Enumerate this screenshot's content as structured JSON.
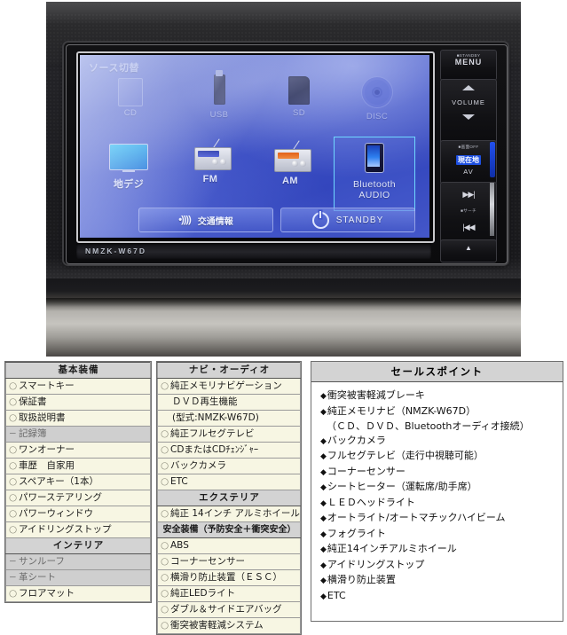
{
  "photo": {
    "alt_name": "car-audio-head-unit-photo",
    "device_model_badge": "NMZK-W67D",
    "screen": {
      "title": "ソース切替",
      "sources_row1": [
        {
          "label": "CD",
          "icon": "cd-icon"
        },
        {
          "label": "USB",
          "icon": "usb-icon"
        },
        {
          "label": "SD",
          "icon": "sd-card-icon"
        },
        {
          "label": "DISC",
          "icon": "disc-icon"
        }
      ],
      "sources_row2": [
        {
          "label": "地デジ",
          "icon": "tv-icon"
        },
        {
          "label": "FM",
          "icon": "radio-fm-icon"
        },
        {
          "label": "AM",
          "icon": "radio-am-icon"
        },
        {
          "label": "Bluetooth",
          "label2": "AUDIO",
          "icon": "smartphone-icon"
        }
      ],
      "traffic_button": "交通情報",
      "standby_button": "STANDBY"
    },
    "hardware_buttons": {
      "menu_caption": "■STANDBY",
      "menu_label": "MENU",
      "volume_label": "VOLUME",
      "av_caption": "■画面OFF",
      "av_blue": "現在地",
      "av_label": "AV",
      "track_next": "▶▶|",
      "track_caption": "■サーチ",
      "track_prev": "|◀◀",
      "eject": "▲"
    }
  },
  "col1": {
    "header": "基本装備",
    "rows": [
      {
        "mark": "○",
        "text": "スマートキー",
        "state": "on"
      },
      {
        "mark": "○",
        "text": "保証書",
        "state": "on"
      },
      {
        "mark": "○",
        "text": "取扱説明書",
        "state": "on"
      },
      {
        "mark": "−",
        "text": "記録簿",
        "state": "off"
      },
      {
        "mark": "○",
        "text": "ワンオーナー",
        "state": "on"
      },
      {
        "mark": "○",
        "text": "車歴　自家用",
        "state": "on"
      },
      {
        "mark": "○",
        "text": "スペアキー（1本）",
        "state": "on"
      },
      {
        "mark": "○",
        "text": "パワーステアリング",
        "state": "on"
      },
      {
        "mark": "○",
        "text": "パワーウィンドウ",
        "state": "on"
      },
      {
        "mark": "○",
        "text": "アイドリングストップ",
        "state": "on"
      },
      {
        "header": "インテリア"
      },
      {
        "mark": "−",
        "text": "サンルーフ",
        "state": "off"
      },
      {
        "mark": "−",
        "text": "革シート",
        "state": "off"
      },
      {
        "mark": "○",
        "text": "フロアマット",
        "state": "on"
      }
    ]
  },
  "col2": {
    "header": "ナビ・オーディオ",
    "rows": [
      {
        "mark": "○",
        "text": "純正メモリナビゲーション",
        "state": "on"
      },
      {
        "cont": "ＤＶＤ再生機能"
      },
      {
        "cont": "(型式:NMZK-W67D)"
      },
      {
        "mark": "○",
        "text": "純正フルセグテレビ",
        "state": "on"
      },
      {
        "mark": "○",
        "text": "CDまたはCDﾁｪﾝｼﾞｬｰ",
        "state": "on"
      },
      {
        "mark": "○",
        "text": "バックカメラ",
        "state": "on"
      },
      {
        "mark": "○",
        "text": "ETC",
        "state": "on"
      },
      {
        "header": "エクステリア"
      },
      {
        "mark": "○",
        "text": "純正 14インチ アルミホイール",
        "state": "on"
      },
      {
        "header_sub": "安全装備（予防安全＋衝突安全）"
      },
      {
        "mark": "○",
        "text": "ABS",
        "state": "on"
      },
      {
        "mark": "○",
        "text": "コーナーセンサー",
        "state": "on"
      },
      {
        "mark": "○",
        "text": "横滑り防止装置（ＥＳＣ）",
        "state": "on"
      },
      {
        "mark": "○",
        "text": "純正LEDライト",
        "state": "on"
      },
      {
        "mark": "○",
        "text": "ダブル＆サイドエアバッグ",
        "state": "on"
      },
      {
        "mark": "○",
        "text": "衝突被害軽減システム",
        "state": "on"
      }
    ]
  },
  "col3": {
    "header": "セールスポイント",
    "bullet": "◆",
    "lines": [
      {
        "bullet": true,
        "text": "衝突被害軽減ブレーキ"
      },
      {
        "bullet": true,
        "text": "純正メモリナビ（NMZK-W67D）"
      },
      {
        "bullet": false,
        "text": "（ＣＤ、ＤＶＤ、Bluetoothオーディオ接続）"
      },
      {
        "bullet": true,
        "text": "バックカメラ"
      },
      {
        "bullet": true,
        "text": "フルセグテレビ（走行中視聴可能）"
      },
      {
        "bullet": true,
        "text": "コーナーセンサー"
      },
      {
        "bullet": true,
        "text": "シートヒーター（運転席/助手席）"
      },
      {
        "bullet": true,
        "text": "ＬＥＤヘッドライト"
      },
      {
        "bullet": true,
        "text": "オートライト/オートマチックハイビーム"
      },
      {
        "bullet": true,
        "text": "フォグライト"
      },
      {
        "bullet": true,
        "text": "純正14インチアルミホイール"
      },
      {
        "bullet": true,
        "text": "アイドリングストップ"
      },
      {
        "bullet": true,
        "text": "横滑り防止装置"
      },
      {
        "bullet": true,
        "text": "ETC"
      }
    ]
  },
  "colors": {
    "header_gray": "#d3d3d3",
    "row_cream": "#f7f6e3",
    "row_disabled": "#cfcfcf",
    "screen_blue": "#3c4fc4",
    "accent_blue": "#1d4fe0",
    "highlight_cyan": "#6fd8ff"
  }
}
